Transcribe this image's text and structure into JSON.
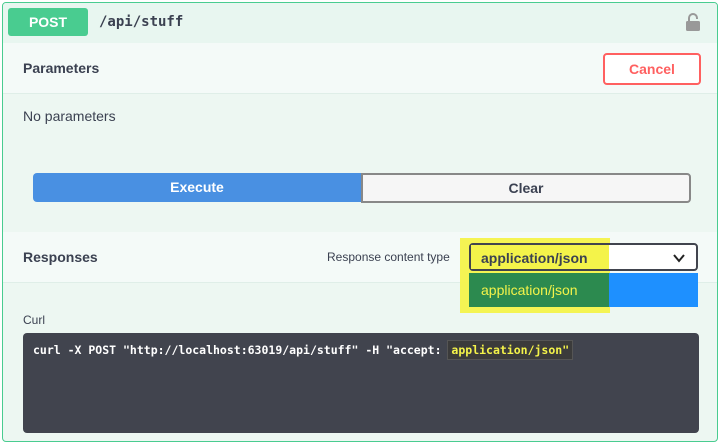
{
  "operation": {
    "method": "POST",
    "path": "/api/stuff"
  },
  "parameters": {
    "title": "Parameters",
    "cancel_label": "Cancel",
    "empty_text": "No parameters",
    "execute_label": "Execute",
    "clear_label": "Clear"
  },
  "responses": {
    "title": "Responses",
    "content_type_label": "Response content type",
    "selected_content_type": "application/json",
    "options": [
      "application/json"
    ]
  },
  "curl": {
    "label": "Curl",
    "command_prefix": "curl -X POST \"http://localhost:63019/api/stuff\" -H \"accept: ",
    "command_highlight": "application/json\""
  },
  "icons": {
    "lock": "lock-icon",
    "chevron": "chevron-down-icon"
  },
  "colors": {
    "post_green": "#49cc90",
    "execute_blue": "#4990e2",
    "cancel_red": "#ff6060",
    "highlight_yellow": "#f4f34a"
  }
}
